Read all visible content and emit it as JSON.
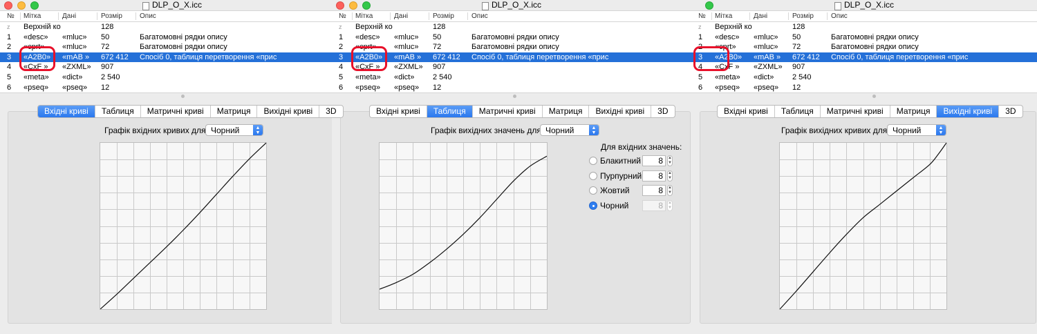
{
  "file_title": "DLP_O_X.icc",
  "columns": [
    "№",
    "Мітка",
    "Дані",
    "Розмір",
    "Опис"
  ],
  "rows": [
    {
      "no": "z",
      "tag": "Верхній ко",
      "data": "",
      "size": "128",
      "desc": ""
    },
    {
      "no": "1",
      "tag": "«desc»",
      "data": "«mluc»",
      "size": "50",
      "desc": "Багатомовні рядки опису"
    },
    {
      "no": "2",
      "tag": "«cprt»",
      "data": "«mluc»",
      "size": "72",
      "desc": "Багатомовні рядки опису"
    },
    {
      "no": "3",
      "tag": "«A2B0»",
      "data": "«mAB »",
      "size": "672 412",
      "desc": "Спосіб 0, таблиця перетворення «прис"
    },
    {
      "no": "4",
      "tag": "«CxF »",
      "data": "«ZXML»",
      "size": "907",
      "desc": ""
    },
    {
      "no": "5",
      "tag": "«meta»",
      "data": "«dict»",
      "size": "2 540",
      "desc": ""
    },
    {
      "no": "6",
      "tag": "«pseq»",
      "data": "«pseq»",
      "size": "12",
      "desc": ""
    }
  ],
  "selected_row": 3,
  "tabs": [
    "Вхідні криві",
    "Таблиця",
    "Матричні криві",
    "Матриця",
    "Вихідні криві",
    "3D"
  ],
  "windows": [
    {
      "active_tab": "Вхідні криві",
      "graph_label": "Графік вхідних кривих для:",
      "channel": "Чорний"
    },
    {
      "active_tab": "Таблиця",
      "graph_label": "Графік вихідних значень для:",
      "channel": "Чорний",
      "inputs_title": "Для вхідних значень:",
      "inputs": [
        {
          "label": "Блакитний",
          "value": "8",
          "selected": false
        },
        {
          "label": "Пурпурний",
          "value": "8",
          "selected": false
        },
        {
          "label": "Жовтий",
          "value": "8",
          "selected": false
        },
        {
          "label": "Чорний",
          "value": "8",
          "selected": true
        }
      ]
    },
    {
      "active_tab": "Вихідні криві",
      "graph_label": "Графік вихідних кривих для:",
      "channel": "Чорний"
    }
  ],
  "colors": {
    "selection": "#2470d8",
    "annotation": "#e8102a",
    "tab_active": "#2b78ee"
  },
  "window_lights": [
    [
      "close",
      "minimize",
      "zoom"
    ],
    [
      "close",
      "minimize",
      "zoom"
    ],
    [
      "zoom"
    ]
  ],
  "curves": [
    {
      "description": "input curve",
      "points": [
        [
          0,
          0
        ],
        [
          0.1,
          0.09
        ],
        [
          0.2,
          0.185
        ],
        [
          0.3,
          0.28
        ],
        [
          0.4,
          0.375
        ],
        [
          0.5,
          0.475
        ],
        [
          0.6,
          0.58
        ],
        [
          0.7,
          0.69
        ],
        [
          0.8,
          0.8
        ],
        [
          0.9,
          0.905
        ],
        [
          1,
          1
        ]
      ]
    },
    {
      "description": "table output",
      "points": [
        [
          0,
          0.12
        ],
        [
          0.1,
          0.16
        ],
        [
          0.2,
          0.21
        ],
        [
          0.3,
          0.28
        ],
        [
          0.4,
          0.36
        ],
        [
          0.5,
          0.45
        ],
        [
          0.6,
          0.55
        ],
        [
          0.7,
          0.66
        ],
        [
          0.8,
          0.77
        ],
        [
          0.9,
          0.86
        ],
        [
          1,
          0.92
        ]
      ]
    },
    {
      "description": "output curve",
      "points": [
        [
          0,
          0
        ],
        [
          0.1,
          0.11
        ],
        [
          0.2,
          0.225
        ],
        [
          0.3,
          0.34
        ],
        [
          0.4,
          0.45
        ],
        [
          0.5,
          0.55
        ],
        [
          0.6,
          0.63
        ],
        [
          0.7,
          0.71
        ],
        [
          0.8,
          0.79
        ],
        [
          0.9,
          0.87
        ],
        [
          0.95,
          0.93
        ],
        [
          1,
          1
        ]
      ]
    }
  ]
}
